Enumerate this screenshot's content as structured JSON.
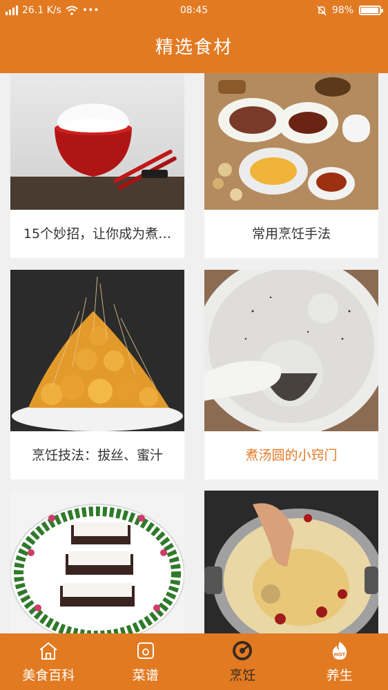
{
  "status_bar": {
    "network": "26.1 K/s",
    "time": "08:45",
    "battery": "98%",
    "battery_level": 0.98
  },
  "header": {
    "title": "精选食材"
  },
  "cards": [
    {
      "title": "15个妙招，让你成为煮…",
      "image": "rice-bowl-photo"
    },
    {
      "title": "常用烹饪手法",
      "image": "spread-dishes-photo"
    },
    {
      "title": "烹饪技法：拔丝、蜜汁",
      "image": "candied-fritters-photo"
    },
    {
      "title": "煮汤圆的小窍门",
      "image": "tangyuan-soup-photo",
      "highlighted": true
    },
    {
      "title": "",
      "image": "tofu-plate-photo"
    },
    {
      "title": "",
      "image": "chicken-hotpot-photo"
    }
  ],
  "tabs": [
    {
      "label": "美食百科",
      "icon": "home-icon",
      "active": false
    },
    {
      "label": "菜谱",
      "icon": "recipe-icon",
      "active": false
    },
    {
      "label": "烹饪",
      "icon": "cooking-icon",
      "active": true
    },
    {
      "label": "养生",
      "icon": "hot-icon",
      "active": false
    }
  ],
  "colors": {
    "accent": "#e27a22",
    "active_tab": "#3a2a20",
    "highlight_text": "#e27a22"
  }
}
